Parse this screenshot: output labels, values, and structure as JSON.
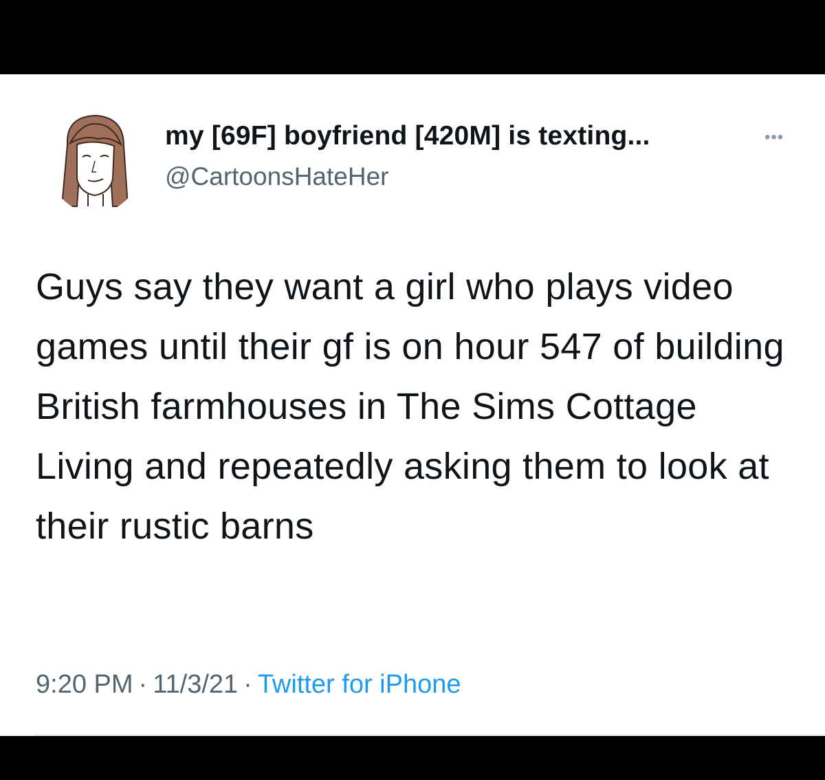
{
  "tweet": {
    "author": {
      "display_name": "my [69F] boyfriend [420M] is texting...",
      "handle": "@CartoonsHateHer",
      "avatar_icon": "cartoon-woman-avatar"
    },
    "more_icon": "more-options-icon",
    "text": "Guys say they want a girl who plays video games until their gf is on hour 547 of building British farmhouses in The Sims Cottage Living and repeatedly asking them to look at their rustic barns",
    "time": "9:20 PM",
    "date": "11/3/21",
    "source": "Twitter for iPhone",
    "separator": "·"
  },
  "colors": {
    "background": "#ffffff",
    "frame": "#000000",
    "text_primary": "#0f1419",
    "text_secondary": "#536471",
    "link": "#1d9bf0"
  }
}
